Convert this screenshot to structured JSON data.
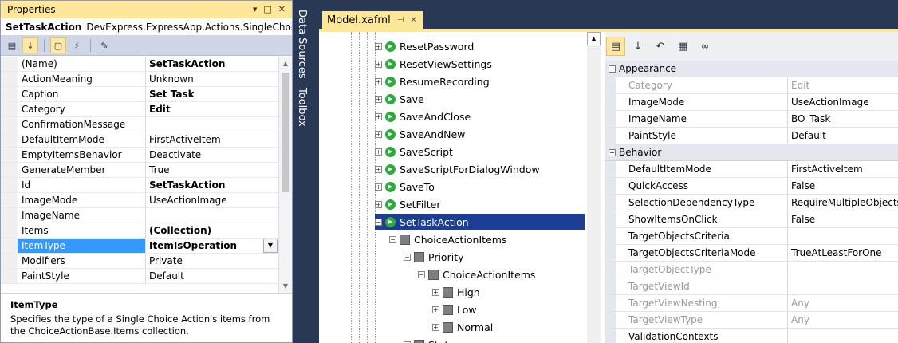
{
  "properties_panel": {
    "title": "Properties",
    "object_name": "SetTaskAction",
    "object_type": "DevExpress.ExpressApp.Actions.SingleChoiceAc",
    "rows": [
      {
        "name": "(Name)",
        "value": "SetTaskAction"
      },
      {
        "name": "ActionMeaning",
        "value": "Unknown"
      },
      {
        "name": "Caption",
        "value": "Set Task"
      },
      {
        "name": "Category",
        "value": "Edit"
      },
      {
        "name": "ConfirmationMessage",
        "value": ""
      },
      {
        "name": "DefaultItemMode",
        "value": "FirstActiveItem"
      },
      {
        "name": "EmptyItemsBehavior",
        "value": "Deactivate"
      },
      {
        "name": "GenerateMember",
        "value": "True"
      },
      {
        "name": "Id",
        "value": "SetTaskAction"
      },
      {
        "name": "ImageMode",
        "value": "UseActionImage"
      },
      {
        "name": "ImageName",
        "value": ""
      },
      {
        "name": "Items",
        "value": "(Collection)"
      },
      {
        "name": "ItemType",
        "value": "ItemIsOperation"
      },
      {
        "name": "Modifiers",
        "value": "Private"
      },
      {
        "name": "PaintStyle",
        "value": "Default"
      }
    ],
    "description_title": "ItemType",
    "description_text": "Specifies the type of a Single Choice Action's items from the ChoiceActionBase.Items collection."
  },
  "side_tabs": [
    "Data Sources",
    "Toolbox"
  ],
  "document_tab": {
    "title": "Model.xafml"
  },
  "tree": {
    "actions": [
      "ResetPassword",
      "ResetViewSettings",
      "ResumeRecording",
      "Save",
      "SaveAndClose",
      "SaveAndNew",
      "SaveScript",
      "SaveScriptForDialogWindow",
      "SaveTo",
      "SetFilter",
      "SetTaskAction"
    ],
    "sub": [
      "ChoiceActionItems",
      "Priority",
      "ChoiceActionItems",
      "High",
      "Low",
      "Normal",
      "Status"
    ]
  },
  "model_grid": {
    "categories": [
      {
        "name": "Appearance",
        "rows": [
          {
            "name": "Category",
            "value": "Edit",
            "dim": true
          },
          {
            "name": "ImageMode",
            "value": "UseActionImage"
          },
          {
            "name": "ImageName",
            "value": "BO_Task"
          },
          {
            "name": "PaintStyle",
            "value": "Default"
          }
        ]
      },
      {
        "name": "Behavior",
        "rows": [
          {
            "name": "DefaultItemMode",
            "value": "FirstActiveItem"
          },
          {
            "name": "QuickAccess",
            "value": "False"
          },
          {
            "name": "SelectionDependencyType",
            "value": "RequireMultipleObjects"
          },
          {
            "name": "ShowItemsOnClick",
            "value": "False"
          },
          {
            "name": "TargetObjectsCriteria",
            "value": ""
          },
          {
            "name": "TargetObjectsCriteriaMode",
            "value": "TrueAtLeastForOne"
          },
          {
            "name": "TargetObjectType",
            "value": "",
            "dim": true
          },
          {
            "name": "TargetViewId",
            "value": "",
            "dim": true
          },
          {
            "name": "TargetViewNesting",
            "value": "Any",
            "dim": true
          },
          {
            "name": "TargetViewType",
            "value": "Any",
            "dim": true
          },
          {
            "name": "ValidationContexts",
            "value": ""
          }
        ]
      }
    ]
  }
}
